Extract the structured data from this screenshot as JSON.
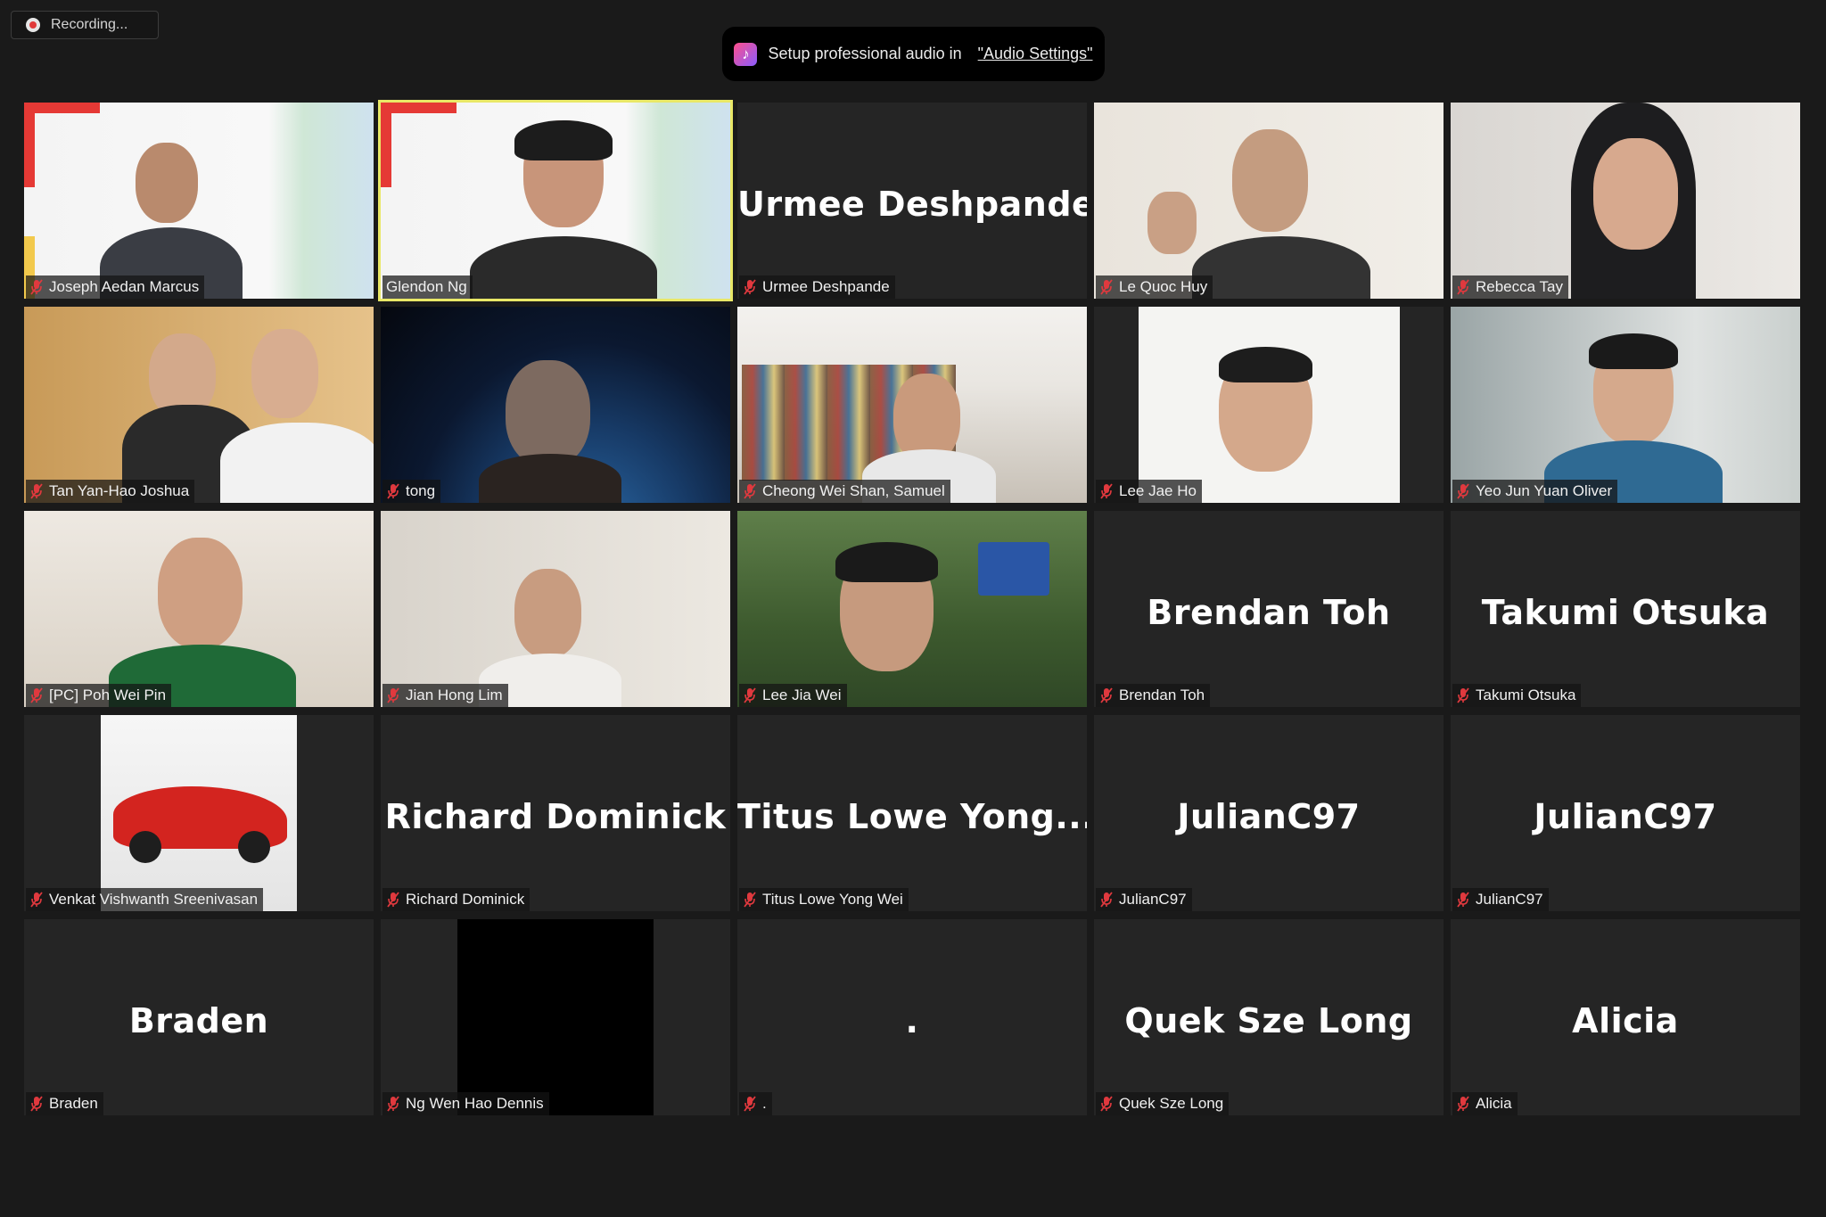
{
  "recording": {
    "label": "Recording..."
  },
  "banner": {
    "text": "Setup professional audio in",
    "link": "\"Audio Settings\""
  },
  "tiles": [
    {
      "name": "Joseph Aedan Marcus"
    },
    {
      "name": "Glendon Ng"
    },
    {
      "name": "Urmee Deshpande",
      "display": "Urmee Deshpande"
    },
    {
      "name": "Le Quoc Huy"
    },
    {
      "name": "Rebecca Tay"
    },
    {
      "name": "Tan Yan-Hao Joshua"
    },
    {
      "name": "tong"
    },
    {
      "name": "Cheong Wei Shan, Samuel"
    },
    {
      "name": "Lee Jae Ho"
    },
    {
      "name": "Yeo Jun Yuan Oliver"
    },
    {
      "name": "[PC] Poh Wei Pin"
    },
    {
      "name": "Jian Hong Lim"
    },
    {
      "name": "Lee Jia Wei"
    },
    {
      "name": "Brendan Toh",
      "display": "Brendan Toh"
    },
    {
      "name": "Takumi Otsuka",
      "display": "Takumi Otsuka"
    },
    {
      "name": "Venkat Vishwanth Sreenivasan"
    },
    {
      "name": "Richard Dominick",
      "display": "Richard Dominick"
    },
    {
      "name": "Titus Lowe Yong Wei",
      "display": "Titus  Lowe  Yong..."
    },
    {
      "name": "JulianC97",
      "display": "JulianC97"
    },
    {
      "name": "JulianC97",
      "display": "JulianC97"
    },
    {
      "name": "Braden",
      "display": "Braden"
    },
    {
      "name": "Ng Wen Hao Dennis"
    },
    {
      "name": ".",
      "display": "."
    },
    {
      "name": "Quek Sze Long",
      "display": "Quek Sze Long"
    },
    {
      "name": "Alicia",
      "display": "Alicia"
    }
  ],
  "colors": {
    "active_border": "#e9e867",
    "tile_bg": "#252525",
    "mute_red": "#e0393e"
  }
}
